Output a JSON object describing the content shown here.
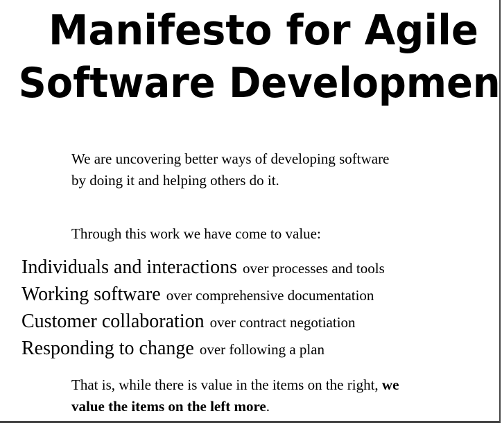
{
  "title": {
    "line1": "Manifesto for Agile",
    "line2": "Software Development"
  },
  "intro": "We are uncovering better ways of developing software by doing it and helping others do it.",
  "through": "Through this work we have come to value:",
  "values": [
    {
      "left": "Individuals and interactions",
      "right": "over processes and tools"
    },
    {
      "left": "Working software",
      "right": "over comprehensive documentation"
    },
    {
      "left": "Customer collaboration",
      "right": "over contract negotiation"
    },
    {
      "left": "Responding to change",
      "right": "over following a plan"
    }
  ],
  "closing": {
    "plain": "That is, while there is value in the items on the right,",
    "bold": "we value the items on the left more",
    "end": "."
  }
}
